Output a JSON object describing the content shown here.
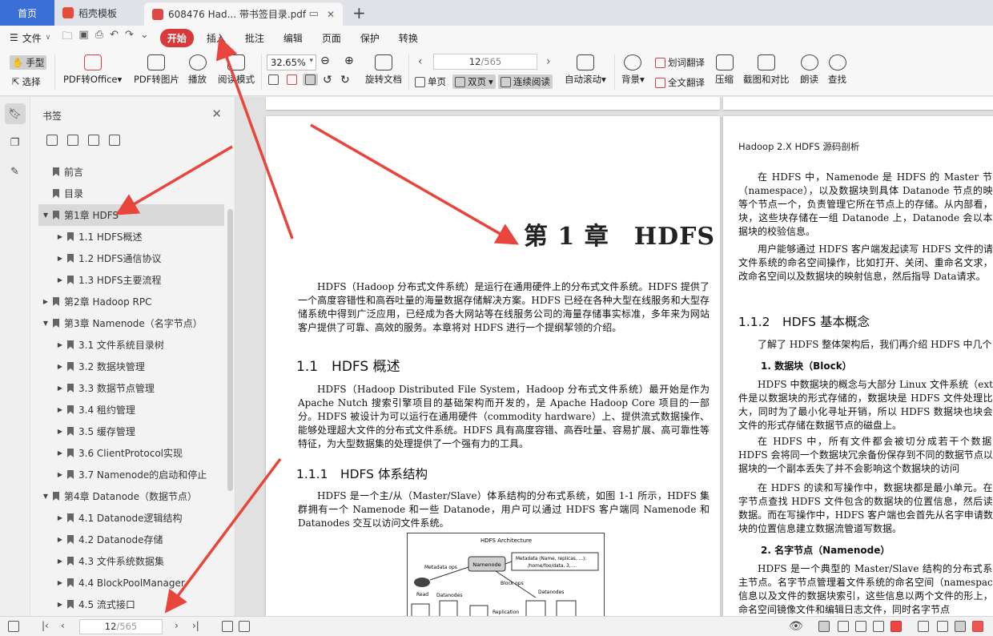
{
  "tabs": {
    "home": "首页",
    "template": "稻壳模板",
    "document": "608476 Had... 带书签目录.pdf",
    "new_tab": "+"
  },
  "menu": {
    "file": "文件",
    "items": [
      "开始",
      "插入",
      "批注",
      "编辑",
      "页面",
      "保护",
      "转换"
    ],
    "active": "开始"
  },
  "toolbar": {
    "hand": "手型",
    "select": "选择",
    "pdf_to_office": "PDF转Office",
    "pdf_to_image": "PDF转图片",
    "play": "播放",
    "read_mode": "阅读模式",
    "zoom": "32.65%",
    "page_current": "12",
    "page_total": "/565",
    "rotate": "旋转文档",
    "single_page": "单页",
    "double_page": "双页",
    "continuous": "连续阅读",
    "auto_scroll": "自动滚动",
    "background": "背景",
    "word_translate": "划词翻译",
    "full_translate": "全文翻译",
    "compress": "压缩",
    "screenshot_compare": "截图和对比",
    "read_aloud": "朗读",
    "find": "查找"
  },
  "bookmarks": {
    "title": "书签",
    "items": [
      {
        "label": "前言",
        "level": 0,
        "arrow": ""
      },
      {
        "label": "目录",
        "level": 0,
        "arrow": ""
      },
      {
        "label": "第1章 HDFS",
        "level": 0,
        "arrow": "▼",
        "selected": true
      },
      {
        "label": "1.1 HDFS概述",
        "level": 1,
        "arrow": "▶"
      },
      {
        "label": "1.2 HDFS通信协议",
        "level": 1,
        "arrow": "▶"
      },
      {
        "label": "1.3 HDFS主要流程",
        "level": 1,
        "arrow": "▶"
      },
      {
        "label": "第2章 Hadoop RPC",
        "level": 0,
        "arrow": "▶"
      },
      {
        "label": "第3章 Namenode（名字节点）",
        "level": 0,
        "arrow": "▼"
      },
      {
        "label": "3.1 文件系统目录树",
        "level": 1,
        "arrow": "▶"
      },
      {
        "label": "3.2 数据块管理",
        "level": 1,
        "arrow": "▶"
      },
      {
        "label": "3.3 数据节点管理",
        "level": 1,
        "arrow": "▶"
      },
      {
        "label": "3.4 租约管理",
        "level": 1,
        "arrow": "▶"
      },
      {
        "label": "3.5 缓存管理",
        "level": 1,
        "arrow": "▶"
      },
      {
        "label": "3.6 ClientProtocol实现",
        "level": 1,
        "arrow": "▶"
      },
      {
        "label": "3.7 Namenode的启动和停止",
        "level": 1,
        "arrow": "▶"
      },
      {
        "label": "第4章 Datanode（数据节点）",
        "level": 0,
        "arrow": "▼"
      },
      {
        "label": "4.1 Datanode逻辑结构",
        "level": 1,
        "arrow": "▶"
      },
      {
        "label": "4.2 Datanode存储",
        "level": 1,
        "arrow": "▶"
      },
      {
        "label": "4.3 文件系统数据集",
        "level": 1,
        "arrow": "▶"
      },
      {
        "label": "4.4 BlockPoolManager",
        "level": 1,
        "arrow": "▶"
      },
      {
        "label": "4.5 流式接口",
        "level": 1,
        "arrow": "▶"
      }
    ]
  },
  "page_left": {
    "chapter_title": "第 1 章　HDFS",
    "intro": "HDFS（Hadoop 分布式文件系统）是运行在通用硬件上的分布式文件系统。HDFS 提供了一个高度容错性和高吞吐量的海量数据存储解决方案。HDFS 已经在各种大型在线服务和大型存储系统中得到广泛应用，已经成为各大网站等在线服务公司的海量存储事实标准，多年来为网站客户提供了可靠、高效的服务。本章将对 HDFS 进行一个提纲挈领的介绍。",
    "h11": "1.1　HDFS 概述",
    "p11": "HDFS（Hadoop Distributed File System，Hadoop 分布式文件系统）最开始是作为 Apache Nutch 搜索引擎项目的基础架构而开发的，是 Apache Hadoop Core 项目的一部分。HDFS 被设计为可以运行在通用硬件（commodity hardware）上、提供流式数据操作、能够处理超大文件的分布式文件系统。HDFS 具有高度容错、高吞吐量、容易扩展、高可靠性等特征，为大型数据集的处理提供了一个强有力的工具。",
    "h111": "1.1.1　HDFS 体系结构",
    "p111": "HDFS 是一个主/从（Master/Slave）体系结构的分布式系统，如图 1-1 所示，HDFS 集群拥有一个 Namenode 和一些 Datanode，用户可以通过 HDFS 客户端同 Namenode 和 Datanodes 交互以访问文件系统。",
    "diagram": {
      "title": "HDFS Architecture",
      "namenode": "Namenode",
      "metadata_ops": "Metadata ops",
      "metadata": "Metadata (Name, replicas, ...):",
      "metadata_path": "/home/foo/data, 3, ...",
      "read": "Read",
      "datanodes_left": "Datanodes",
      "block_ops": "Block ops",
      "datanodes_right": "Datanodes",
      "replication": "Replication"
    }
  },
  "page_right": {
    "running_head": "Hadoop 2.X HDFS 源码剖析",
    "p1": "在 HDFS 中，Namenode 是 HDFS 的 Master 节点（namespace），以及数据块到具体 Datanode 节点的映射等个节点一个，负责管理它所在节点上的存储。从内部看，据块，这些块存储在一组 Datanode 上，Datanode 会以本地据块的校验信息。",
    "p2": "用户能够通过 HDFS 客户端发起读写 HDFS 文件的请行文件系统的命名空间操作，比如打开、关闭、重命名文求，更改命名空间以及数据块的映射信息，然后指导 Data请求。",
    "h112": "1.1.2　HDFS 基本概念",
    "p3": "了解了 HDFS 整体架构后，我们再介绍 HDFS 中几个",
    "h_block": "1.  数据块（Block）",
    "p4": "HDFS 中数据块的概念与大部分 Linux 文件系统（ext文件是以数据块的形式存储的，数据块是 HDFS 文件处理比较大，同时为了最小化寻址开销，所以 HDFS 数据块也块会以文件的形式存储在数据节点的磁盘上。",
    "p5": "在 HDFS 中，所有文件都会被切分成若干个数据块HDFS 会将同一个数据块冗余备份保存到不同的数据节点以数据块的一个副本丢失了并不会影响这个数据块的访问",
    "p6": "在 HDFS 的读和写操作中，数据块都是最小单元。在名字节点查找 HDFS 文件包含的数据块的位置信息，然后读取数据。而在写操作中，HDFS 客户端也会首先从名字申请数据块的位置信息建立数据流管道写数据。",
    "h_namenode": "2.  名字节点（Namenode）",
    "p7": "HDFS 是一个典型的 Master/Slave 结构的分布式系统主节点。名字节点管理着文件系统的命名空间（namespac录信息以及文件的数据块索引，这些信息以两个文件的形上，即命名空间镜像文件和编辑日志文件，同时名字节点"
  },
  "statusbar": {
    "page_current": "12",
    "page_total": "/565"
  },
  "colors": {
    "accent": "#d63a3a",
    "home_tab": "#3a6fd8",
    "annotation": "#e8453c"
  }
}
